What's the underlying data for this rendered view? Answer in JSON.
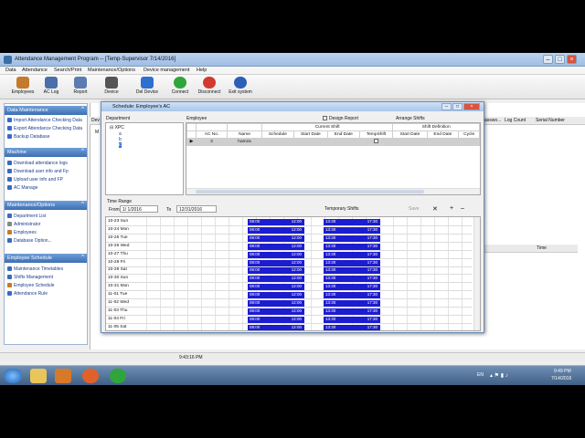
{
  "app": {
    "title": "Attendance Management Program -- [Temp-Supervisor 7/14/2016]",
    "menu": [
      "Data",
      "Attendance",
      "Search/Print",
      "Maintenance/Options",
      "Device management",
      "Help"
    ],
    "toolbar": [
      "Employees",
      "AC Log",
      "Report",
      "Device",
      "Del Device",
      "Connect",
      "Disconnect",
      "Exit system"
    ]
  },
  "sidebar": {
    "sections": [
      {
        "title": "Data Maintenance",
        "items": [
          "Import Attendance Checking Data",
          "Export Attendance Checking Data",
          "Backup Database"
        ]
      },
      {
        "title": "Machine",
        "items": [
          "Download attendance logs",
          "Download user info and Fp",
          "Upload user info and FP",
          "AC Manage"
        ]
      },
      {
        "title": "Maintenance/Options",
        "items": [
          "Department List",
          "Administrator",
          "Employees",
          "Database Option..."
        ]
      },
      {
        "title": "Employee Schedule",
        "items": [
          "Maintenance Timetables",
          "Shifts Management",
          "Employee Schedule",
          "Attendance Rule"
        ]
      }
    ]
  },
  "background": {
    "headers": [
      "Dev",
      "asswo...",
      "Log Count",
      "Serial Number"
    ],
    "time_header": "Time",
    "m": "M"
  },
  "dialog": {
    "title": "Schedule: Employee's AC",
    "department_label": "Department",
    "employee_label": "Employee",
    "design_report": "Design Report",
    "arrange_shifts": "Arrange Shifts",
    "tree": {
      "root": "XPC",
      "children": [
        "a",
        "b",
        "c"
      ]
    },
    "group_headers": {
      "current": "Current Shift",
      "definition": "Shift Definition"
    },
    "columns": [
      "AC No.",
      "Name",
      "Schedule",
      "Start Date",
      "End Date",
      "TempShift",
      "Start Date",
      "End Date",
      "Cycle"
    ],
    "employee_row": {
      "ac_no": "3",
      "name": "hamza"
    },
    "time_range_label": "Time Range",
    "from_label": "From",
    "from_value": "1/ 1/2016",
    "to_label": "To",
    "to_value": "12/31/2016",
    "temporary_shifts": "Temporary Shifts",
    "save": "Save"
  },
  "schedule": [
    {
      "day": "10-23 Sun",
      "on": "08:00",
      "off": "12:00",
      "on2": "13:30",
      "off2": "17:30"
    },
    {
      "day": "10-24 Mon",
      "on": "08:00",
      "off": "12:00",
      "on2": "13:30",
      "off2": "17:30"
    },
    {
      "day": "10-25 Tue",
      "on": "08:00",
      "off": "12:00",
      "on2": "13:30",
      "off2": "17:30"
    },
    {
      "day": "10-26 Wed",
      "on": "08:00",
      "off": "12:00",
      "on2": "13:30",
      "off2": "17:30"
    },
    {
      "day": "10-27 Thu",
      "on": "08:00",
      "off": "12:00",
      "on2": "13:30",
      "off2": "17:30"
    },
    {
      "day": "10-28 Fri",
      "on": "08:00",
      "off": "12:00",
      "on2": "13:30",
      "off2": "17:30"
    },
    {
      "day": "10-29 Sat",
      "on": "08:00",
      "off": "12:00",
      "on2": "13:30",
      "off2": "17:30"
    },
    {
      "day": "10-30 Sun",
      "on": "08:00",
      "off": "12:00",
      "on2": "13:30",
      "off2": "17:30"
    },
    {
      "day": "10-31 Mon",
      "on": "08:00",
      "off": "12:00",
      "on2": "13:30",
      "off2": "17:30"
    },
    {
      "day": "11-01 Tue",
      "on": "08:00",
      "off": "12:00",
      "on2": "13:30",
      "off2": "17:30"
    },
    {
      "day": "11-02 Wed",
      "on": "08:00",
      "off": "12:00",
      "on2": "13:30",
      "off2": "17:30"
    },
    {
      "day": "11-03 Thu",
      "on": "08:00",
      "off": "12:00",
      "on2": "13:30",
      "off2": "17:30"
    },
    {
      "day": "11-04 Fri",
      "on": "08:00",
      "off": "12:00",
      "on2": "13:30",
      "off2": "17:30"
    },
    {
      "day": "11-05 Sat",
      "on": "08:00",
      "off": "12:00",
      "on2": "13:30",
      "off2": "17:30"
    }
  ],
  "status": {
    "time": "9:43:16 PM"
  },
  "taskbar": {
    "lang": "EN",
    "clock_time": "9:49 PM",
    "clock_date": "7/14/2016"
  }
}
